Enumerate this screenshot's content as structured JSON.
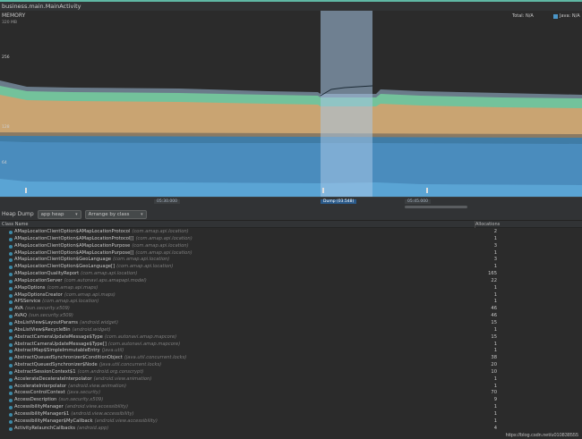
{
  "window": {
    "title": "business.main.MainActivity"
  },
  "memory": {
    "label": "MEMORY",
    "max_label": "320 MB",
    "y_labels": [
      "256",
      "192",
      "128",
      "64"
    ],
    "legend_total": "Total: N/A",
    "legend_java": "Java: N/A",
    "colors": {
      "java": "#4b96c8",
      "native": "#d0a974",
      "graphics": "#75c3a0",
      "stack": "#8ab6d6",
      "others": "#b9b9c4",
      "code": "#9b7bc2",
      "selection": "#8fb2d6"
    }
  },
  "timeline": {
    "ticks": [
      "05:30.000",
      "Dump (03.548)",
      "05:45.000"
    ]
  },
  "toolbar": {
    "heap_dump_label": "Heap Dump",
    "heap_select": "app heap",
    "arrange_select": "Arrange by class"
  },
  "table": {
    "col_name": "Class Name",
    "col_alloc": "Allocations",
    "rows": [
      {
        "name": "AMapLocationClientOption$AMapLocationProtocol",
        "pkg": "(com.amap.api.location)",
        "count": "2"
      },
      {
        "name": "AMapLocationClientOption$AMapLocationProtocol[]",
        "pkg": "(com.amap.api.location)",
        "count": "1"
      },
      {
        "name": "AMapLocationClientOption$AMapLocationPurpose",
        "pkg": "(com.amap.api.location)",
        "count": "3"
      },
      {
        "name": "AMapLocationClientOption$AMapLocationPurpose[]",
        "pkg": "(com.amap.api.location)",
        "count": "1"
      },
      {
        "name": "AMapLocationClientOption$GeoLanguage",
        "pkg": "(com.amap.api.location)",
        "count": "3"
      },
      {
        "name": "AMapLocationClientOption$GeoLanguage[]",
        "pkg": "(com.amap.api.location)",
        "count": "1"
      },
      {
        "name": "AMapLocationQualityReport",
        "pkg": "(com.amap.api.location)",
        "count": "165"
      },
      {
        "name": "AMapLocationServer",
        "pkg": "(com.autonavi.aps.amapapi.model)",
        "count": "22"
      },
      {
        "name": "AMapOptions",
        "pkg": "(com.amap.api.maps)",
        "count": "1"
      },
      {
        "name": "AMapOptionsCreator",
        "pkg": "(com.amap.api.maps)",
        "count": "1"
      },
      {
        "name": "APSService",
        "pkg": "(com.amap.api.location)",
        "count": "1"
      },
      {
        "name": "AVA",
        "pkg": "(sun.security.x509)",
        "count": "46"
      },
      {
        "name": "AVAQ",
        "pkg": "(sun.security.x509)",
        "count": "46"
      },
      {
        "name": "AbsListView$LayoutParams",
        "pkg": "(android.widget)",
        "count": "15"
      },
      {
        "name": "AbsListView$RecycleBin",
        "pkg": "(android.widget)",
        "count": "1"
      },
      {
        "name": "AbstractCameraUpdateMessage$Type",
        "pkg": "(com.autonavi.amap.mapcore)",
        "count": "15"
      },
      {
        "name": "AbstractCameraUpdateMessage$Type[]",
        "pkg": "(com.autonavi.amap.mapcore)",
        "count": "1"
      },
      {
        "name": "AbstractMap$SimpleImmutableEntry",
        "pkg": "(java.util)",
        "count": "1"
      },
      {
        "name": "AbstractQueuedSynchronizer$ConditionObject",
        "pkg": "(java.util.concurrent.locks)",
        "count": "38"
      },
      {
        "name": "AbstractQueuedSynchronizer$Node",
        "pkg": "(java.util.concurrent.locks)",
        "count": "20"
      },
      {
        "name": "AbstractSessionContext$1",
        "pkg": "(com.android.org.conscrypt)",
        "count": "10"
      },
      {
        "name": "AccelerateDecelerateInterpolator",
        "pkg": "(android.view.animation)",
        "count": "1"
      },
      {
        "name": "AccelerateInterpolator",
        "pkg": "(android.view.animation)",
        "count": "1"
      },
      {
        "name": "AccessControlContext",
        "pkg": "(java.security)",
        "count": "70"
      },
      {
        "name": "AccessDescription",
        "pkg": "(sun.security.x509)",
        "count": "9"
      },
      {
        "name": "AccessibilityManager",
        "pkg": "(android.view.accessibility)",
        "count": "1"
      },
      {
        "name": "AccessibilityManager$1",
        "pkg": "(android.view.accessibility)",
        "count": "1"
      },
      {
        "name": "AccessibilityManager$MyCallback",
        "pkg": "(android.view.accessibility)",
        "count": "1"
      },
      {
        "name": "ActivityRelaunchCallbacks",
        "pkg": "(android.app)",
        "count": "4"
      }
    ]
  },
  "watermark": "https://blog.csdn.net/u010838555"
}
